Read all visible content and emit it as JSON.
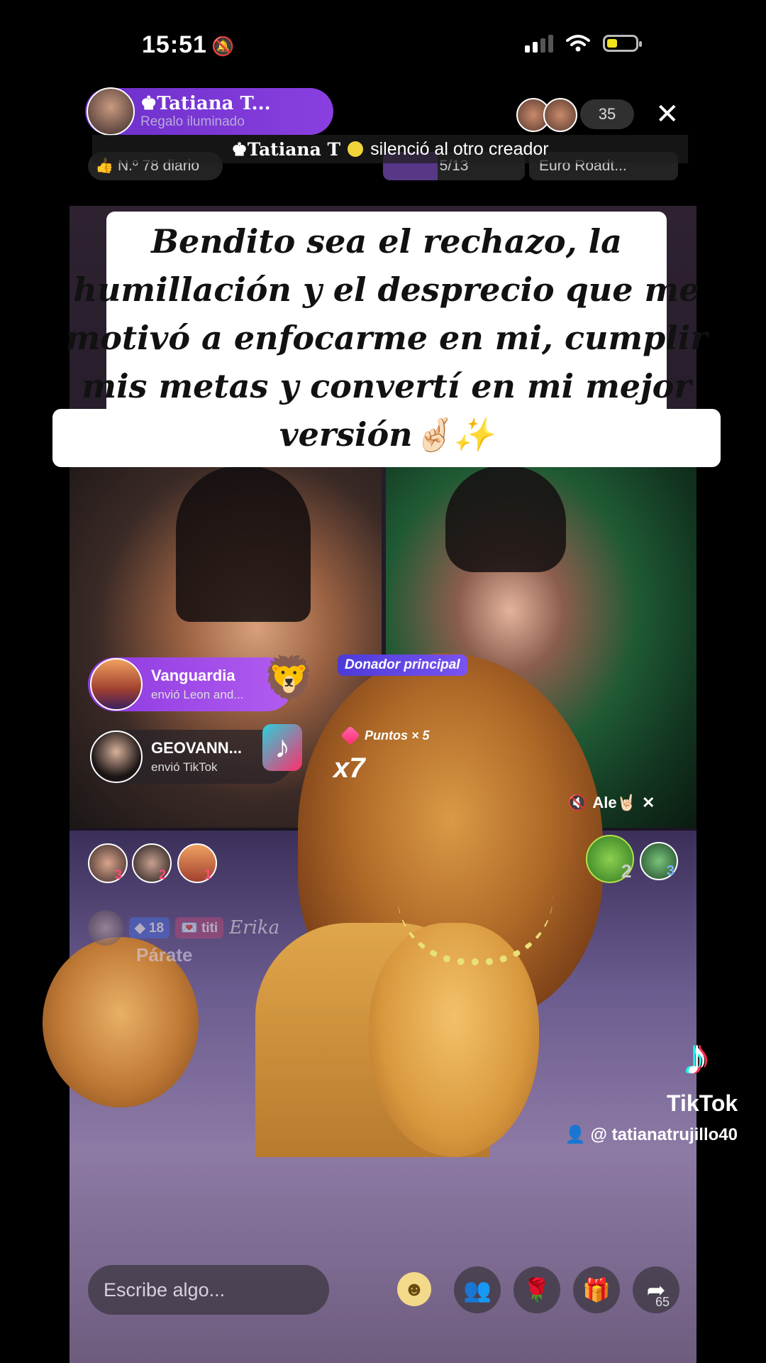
{
  "status_bar": {
    "time": "15:51",
    "bell": "🔕"
  },
  "header": {
    "host_name": "♚Tatiana T...",
    "host_subtitle": "Regalo iluminado",
    "viewer_count": "35",
    "close_symbol": "✕",
    "muted_user": "♚Tatiana T",
    "muted_message": "silenció al otro creador",
    "rank_label": "👍 N.º 78 diario",
    "progress_label": "5/13",
    "progress_fraction": 0.3846,
    "event_label": "Euro Roadt..."
  },
  "caption": {
    "text": "Bendito sea el rechazo, la humillación y el desprecio que me motivó a enfocarme en mi, cumplir mis metas y convertí en mi mejor versión🤞🏻✨"
  },
  "gifts": [
    {
      "name": "Vanguardia",
      "desc": "envió Leon and...",
      "icon": "🦁"
    },
    {
      "name": "GEOVANN...",
      "desc": "envió TikTok",
      "icon": "♪"
    }
  ],
  "gift_combo": "x7",
  "top_donor_label": "Donador principal",
  "points_label": "Puntos × 5",
  "cam_right_user": "Ale🤘🏻",
  "cam_right_mute_icon": "🔇",
  "cam_right_close": "✕",
  "ranking_badges": [
    "3",
    "2",
    "1"
  ],
  "mvp_badges": [
    "2",
    "3"
  ],
  "chat": {
    "level": "◆ 18",
    "fan_badge": "💌 titi",
    "user": "Erika",
    "message": "Párate"
  },
  "watermark": {
    "logo": "♪",
    "brand": "TikTok",
    "handle": "👤 @ tatianatrujillo40"
  },
  "bottom_bar": {
    "placeholder": "Escribe algo...",
    "emoji": "☻",
    "share_count": "65",
    "buttons": [
      "👥",
      "🌹",
      "🎁",
      "➦"
    ]
  },
  "colors": {
    "accent_purple": "#8a3fe0",
    "tiktok_cyan": "#25f4ee",
    "tiktok_red": "#fe2c55"
  }
}
